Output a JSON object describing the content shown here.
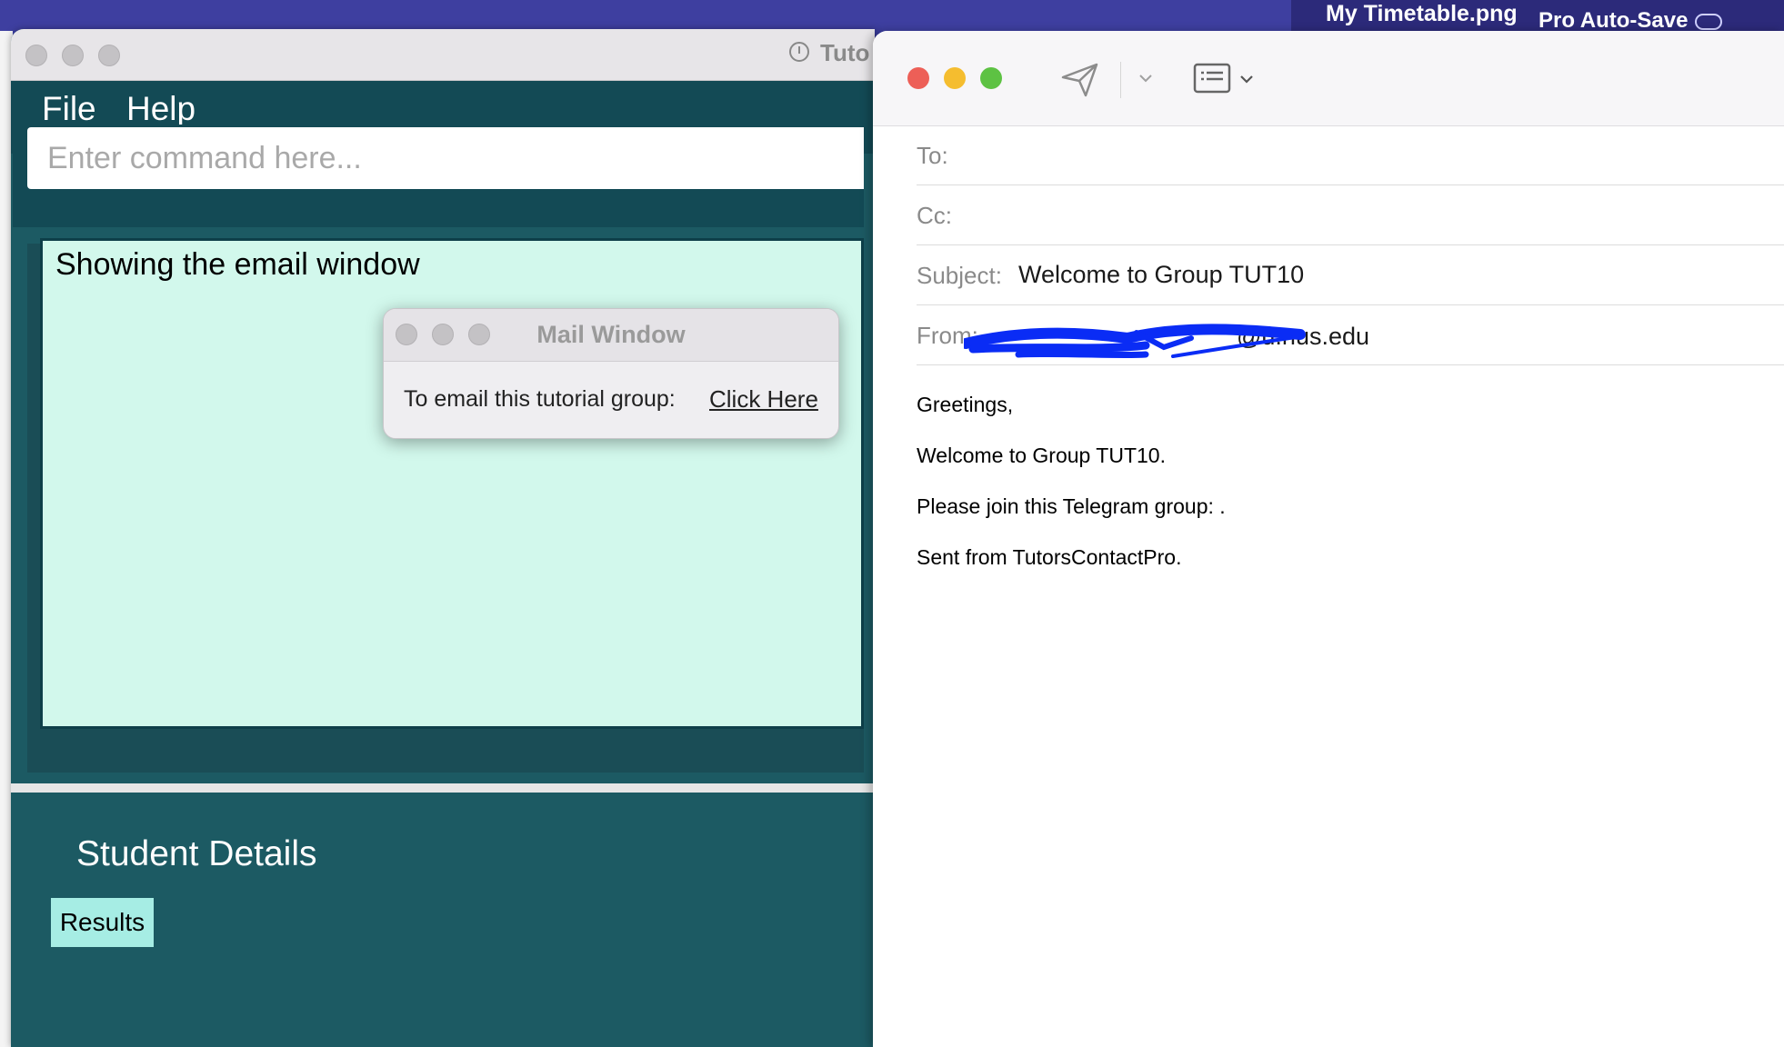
{
  "background_app": {
    "file_title": "My Timetable.png",
    "autosave": "Pro Auto-Save"
  },
  "tcp_window": {
    "title": "Tuto",
    "menu": {
      "file": "File",
      "help": "Help"
    },
    "command": {
      "placeholder": "Enter command here..."
    },
    "result_text": "Showing the email window",
    "student_details_title": "Student Details",
    "results_button": "Results"
  },
  "mail_dialog": {
    "title": "Mail Window",
    "label": "To email this tutorial group:",
    "link": "Click Here"
  },
  "compose": {
    "fields": {
      "to_label": "To:",
      "cc_label": "Cc:",
      "subject_label": "Subject:",
      "subject_value": "Welcome to Group TUT10",
      "from_label": "From:",
      "from_value": "@u.nus.edu"
    },
    "body": {
      "greeting": "Greetings,",
      "line1": "Welcome to Group TUT10.",
      "line2": "Please join this Telegram group: .",
      "signature": "Sent from TutorsContactPro."
    }
  },
  "colors": {
    "traffic_red": "#ed5f57",
    "traffic_yellow": "#f5bd2f",
    "traffic_green": "#5dc243",
    "redaction_blue": "#0a2cf5",
    "teal_dark": "#134a55",
    "result_bg": "#d2f8ec"
  },
  "icons": {
    "send": "send-icon",
    "format": "format-icon",
    "chevron": "chevron-down-icon",
    "clock": "clock-icon",
    "cloud": "cloud-icon"
  }
}
